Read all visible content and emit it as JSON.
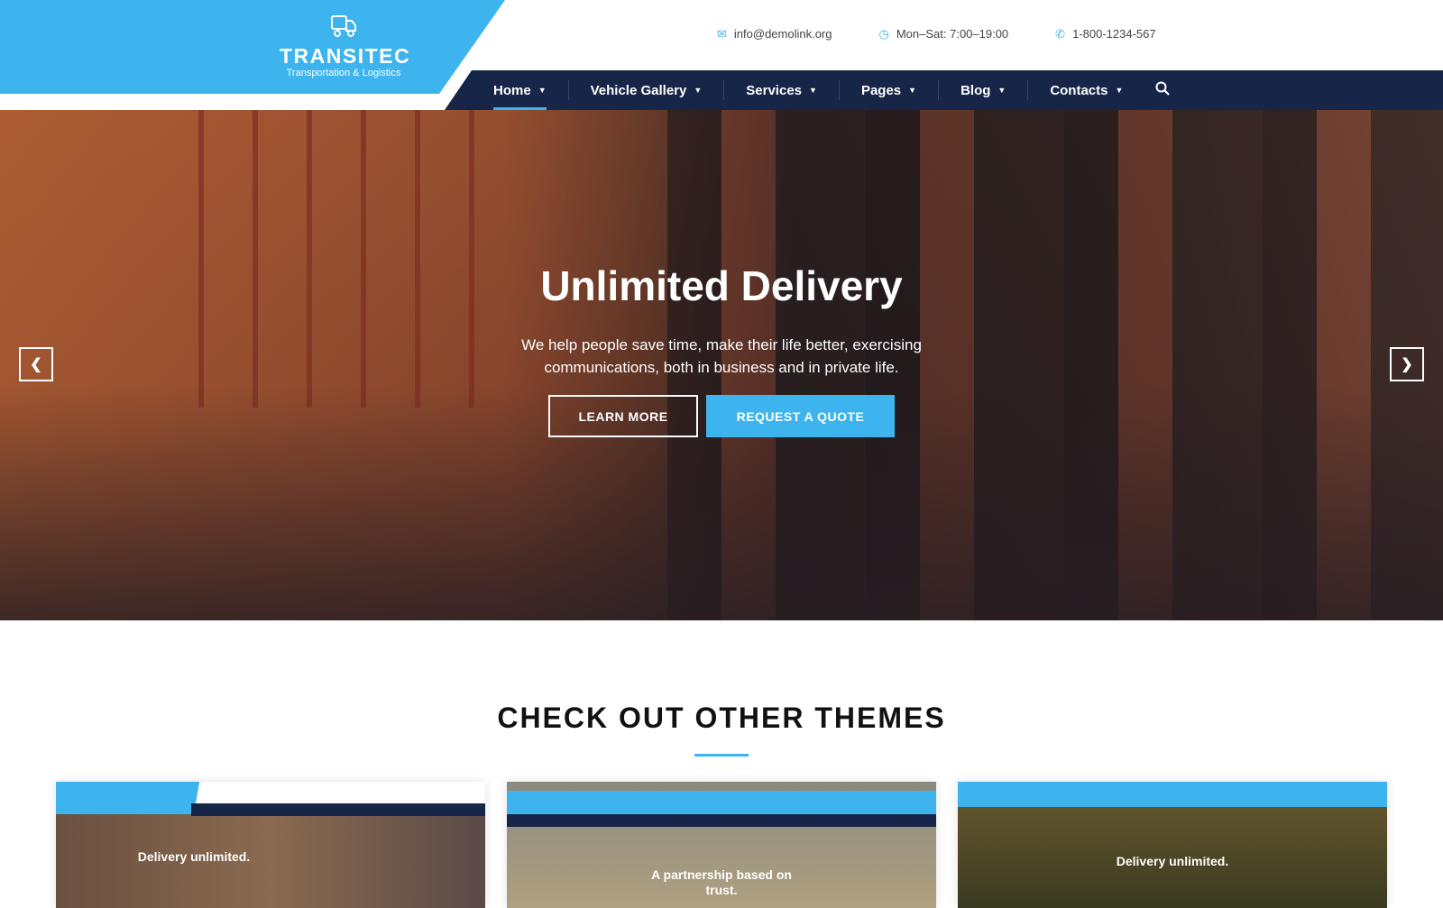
{
  "brand": {
    "name": "TRANSITEC",
    "tagline": "Transportation & Logistics",
    "accent": "#3db4ed",
    "nav_bg": "#172648"
  },
  "contacts": {
    "email": "info@demolink.org",
    "hours": "Mon–Sat: 7:00–19:00",
    "phone": "1-800-1234-567"
  },
  "nav": {
    "items": [
      {
        "label": "Home"
      },
      {
        "label": "Vehicle Gallery"
      },
      {
        "label": "Services"
      },
      {
        "label": "Pages"
      },
      {
        "label": "Blog"
      },
      {
        "label": "Contacts"
      }
    ]
  },
  "hero": {
    "title": "Unlimited Delivery",
    "subtitle": "We help people save time, make their life better, exercising communications, both in business and in private life.",
    "learn_more": "LEARN MORE",
    "request_quote": "REQUEST A QUOTE"
  },
  "themes": {
    "title": "CHECK OUT OTHER THEMES",
    "cards": [
      {
        "headline": "Delivery unlimited."
      },
      {
        "headline": "A partnership based on trust."
      },
      {
        "headline": "Delivery unlimited."
      }
    ]
  }
}
